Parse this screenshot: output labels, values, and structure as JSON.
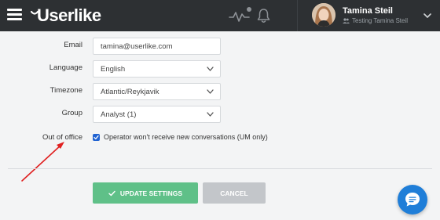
{
  "header": {
    "logo_text": "Userlike",
    "user_name": "Tamina Steil",
    "user_subtitle": "Testing Tamina Steil"
  },
  "form": {
    "email": {
      "label": "Email",
      "value": "tamina@userlike.com"
    },
    "language": {
      "label": "Language",
      "value": "English"
    },
    "timezone": {
      "label": "Timezone",
      "value": "Atlantic/Reykjavik"
    },
    "group": {
      "label": "Group",
      "value": "Analyst (1)"
    },
    "out_of_office": {
      "label": "Out of office",
      "checked": true,
      "text": "Operator won't receive new conversations (UM only)"
    }
  },
  "actions": {
    "update_label": "UPDATE SETTINGS",
    "cancel_label": "CANCEL"
  },
  "colors": {
    "topbar": "#2d3033",
    "update_button": "#5fc088",
    "cancel_button": "#c3c6ca",
    "checkbox": "#2062d1",
    "chat_bubble": "#1f7ed8",
    "annotation_arrow": "#e02020"
  },
  "icons": {
    "menu": "hamburger-icon",
    "activity": "activity-icon",
    "notifications": "bell-icon",
    "user_group": "users-icon",
    "dropdown": "chevron-down-icon",
    "update": "check-icon",
    "chat": "chat-icon"
  }
}
